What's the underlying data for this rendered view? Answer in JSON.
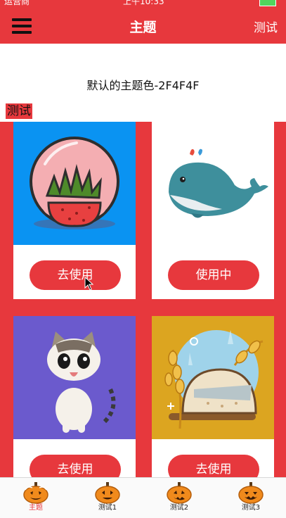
{
  "status_bar": {
    "carrier": "运营商",
    "time": "上午10:33"
  },
  "nav": {
    "title": "主题",
    "right_label": "测试"
  },
  "info_text": "默认的主题色-2F4F4F",
  "tag_label": "测试",
  "themes": [
    {
      "button": "去使用",
      "bg": "#0a93f2",
      "icon": "strawberry-icon"
    },
    {
      "button": "使用中",
      "bg": "#ffffff",
      "icon": "whale-icon"
    },
    {
      "button": "去使用",
      "bg": "#6b5acd",
      "icon": "cat-icon"
    },
    {
      "button": "去使用",
      "bg": "#dca520",
      "icon": "bread-wheat-icon"
    }
  ],
  "tabs": [
    {
      "label": "主题",
      "icon": "pumpkin-icon",
      "active": true
    },
    {
      "label": "测试1",
      "icon": "pumpkin-icon",
      "active": false
    },
    {
      "label": "测试2",
      "icon": "pumpkin-icon",
      "active": false
    },
    {
      "label": "测试3",
      "icon": "pumpkin-icon",
      "active": false
    }
  ],
  "colors": {
    "accent": "#e7383d",
    "tab_active": "#e7383d"
  }
}
